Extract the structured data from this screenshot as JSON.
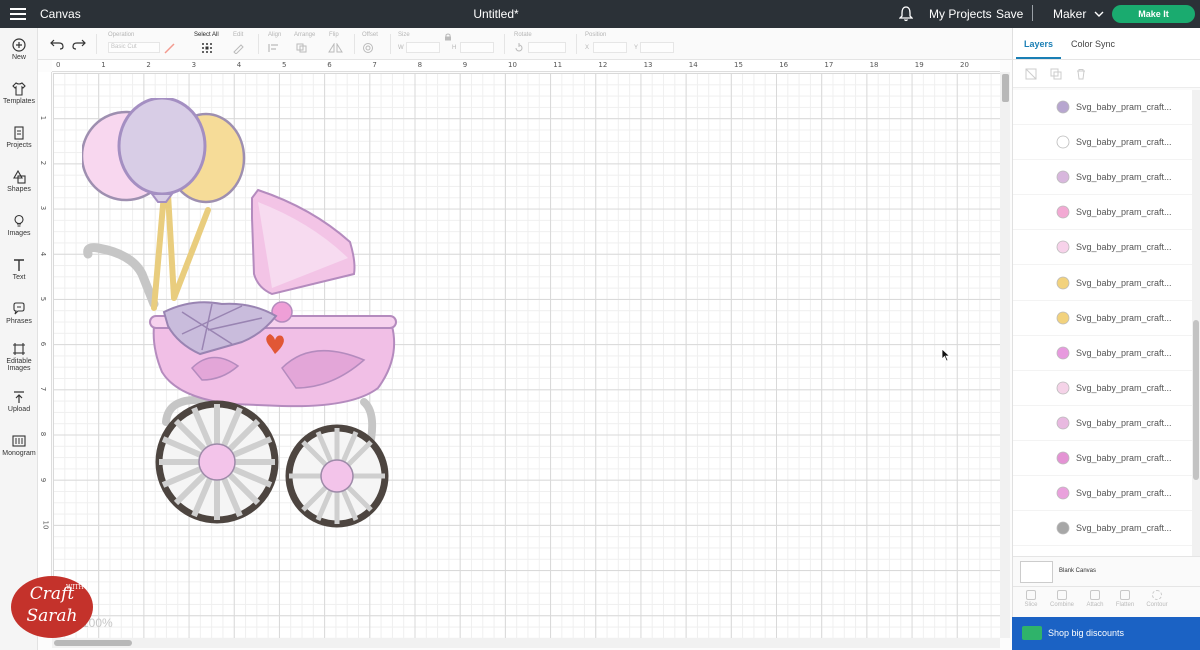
{
  "header": {
    "app_title": "Canvas",
    "doc_title": "Untitled*",
    "my_projects": "My Projects",
    "save": "Save",
    "separator": "|",
    "machine": "Maker",
    "make_it": "Make It"
  },
  "sidebar": {
    "items": [
      {
        "label": "New",
        "icon": "plus-circle-icon"
      },
      {
        "label": "Templates",
        "icon": "shirt-icon"
      },
      {
        "label": "Projects",
        "icon": "projects-icon"
      },
      {
        "label": "Shapes",
        "icon": "shapes-icon"
      },
      {
        "label": "Images",
        "icon": "lightbulb-icon"
      },
      {
        "label": "Text",
        "icon": "text-icon"
      },
      {
        "label": "Phrases",
        "icon": "speech-bubble-icon"
      },
      {
        "label": "Editable Images",
        "icon": "editable-images-icon"
      },
      {
        "label": "Upload",
        "icon": "upload-icon"
      },
      {
        "label": "Monogram",
        "icon": "monogram-icon"
      }
    ]
  },
  "toolbar": {
    "operation_label": "Operation",
    "operation_value": "Basic Cut",
    "select_all": "Select All",
    "edit": "Edit",
    "align": "Align",
    "arrange": "Arrange",
    "flip": "Flip",
    "offset": "Offset",
    "size": "Size",
    "size_w": "W",
    "size_h": "H",
    "rotate": "Rotate",
    "position": "Position",
    "position_x": "X",
    "position_y": "Y"
  },
  "canvas": {
    "ruler_top": [
      "0",
      "1",
      "2",
      "3",
      "4",
      "5",
      "6",
      "7",
      "8",
      "9",
      "10",
      "11",
      "12",
      "13",
      "14",
      "15",
      "16",
      "17",
      "18",
      "19",
      "20"
    ],
    "ruler_left": [
      "1",
      "2",
      "3",
      "4",
      "5",
      "6",
      "7",
      "8",
      "9",
      "10"
    ],
    "zoom": "100%",
    "logo_line1": "Craft",
    "logo_with": "WITH",
    "logo_line2": "Sarah"
  },
  "panel": {
    "tabs": [
      "Layers",
      "Color Sync"
    ],
    "layers": [
      {
        "label": "Svg_baby_pram_craft...",
        "color": "#b7a6cf"
      },
      {
        "label": "Svg_baby_pram_craft...",
        "color": "#ffffff"
      },
      {
        "label": "Svg_baby_pram_craft...",
        "color": "#d8b7dd"
      },
      {
        "label": "Svg_baby_pram_craft...",
        "color": "#f2a9d3"
      },
      {
        "label": "Svg_baby_pram_craft...",
        "color": "#f7d2ea"
      },
      {
        "label": "Svg_baby_pram_craft...",
        "color": "#f2d27d"
      },
      {
        "label": "Svg_baby_pram_craft...",
        "color": "#f2d27d"
      },
      {
        "label": "Svg_baby_pram_craft...",
        "color": "#e79ade"
      },
      {
        "label": "Svg_baby_pram_craft...",
        "color": "#f5d3e8"
      },
      {
        "label": "Svg_baby_pram_craft...",
        "color": "#e8b9e0"
      },
      {
        "label": "Svg_baby_pram_craft...",
        "color": "#e493d4"
      },
      {
        "label": "Svg_baby_pram_craft...",
        "color": "#e9a1dc"
      },
      {
        "label": "Svg_baby_pram_craft...",
        "color": "#a7a7a7"
      }
    ],
    "blank_canvas": "Blank Canvas",
    "bottom_tools": [
      "Slice",
      "Combine",
      "Attach",
      "Flatten",
      "Contour"
    ],
    "shop": "Shop big discounts"
  }
}
